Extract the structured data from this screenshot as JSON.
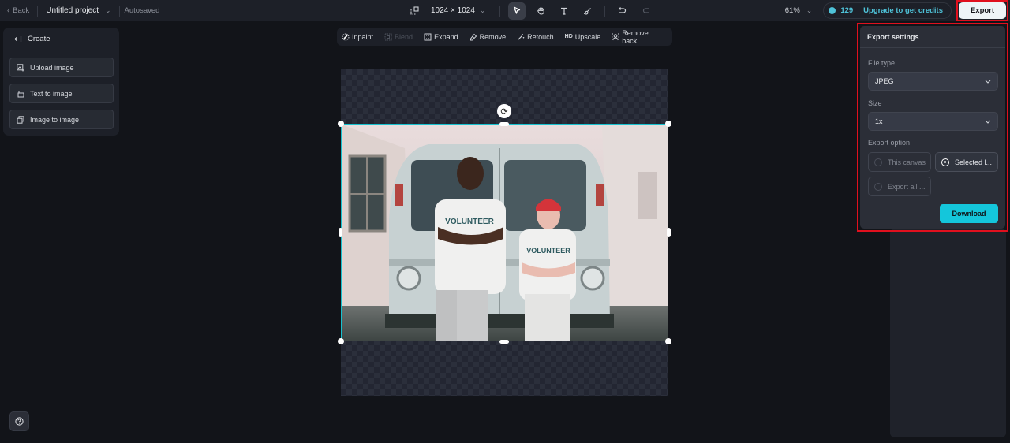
{
  "topbar": {
    "back_label": "Back",
    "project_name": "Untitled project",
    "autosave_status": "Autosaved",
    "canvas_size": "1024 × 1024",
    "zoom_level": "61%",
    "credits_count": "129",
    "upgrade_label": "Upgrade to get credits",
    "export_label": "Export"
  },
  "left_panel": {
    "title": "Create",
    "items": [
      {
        "label": "Upload image",
        "icon": "upload-image-icon"
      },
      {
        "label": "Text to image",
        "icon": "text-to-image-icon"
      },
      {
        "label": "Image to image",
        "icon": "image-to-image-icon"
      }
    ]
  },
  "edit_toolbar": {
    "items": [
      {
        "label": "Inpaint",
        "enabled": true
      },
      {
        "label": "Blend",
        "enabled": false
      },
      {
        "label": "Expand",
        "enabled": true
      },
      {
        "label": "Remove",
        "enabled": true
      },
      {
        "label": "Retouch",
        "enabled": true
      },
      {
        "label": "Upscale",
        "badge": "HD",
        "enabled": true
      },
      {
        "label": "Remove back...",
        "enabled": true
      }
    ]
  },
  "canvas": {
    "image_description": "Two volunteers in VOLUNTEER t-shirts standing in front of a white van",
    "shirt_text": "VOLUNTEER"
  },
  "export_settings": {
    "title": "Export settings",
    "file_type_label": "File type",
    "file_type_value": "JPEG",
    "size_label": "Size",
    "size_value": "1x",
    "export_option_label": "Export option",
    "options": [
      {
        "label": "This canvas",
        "selected": false
      },
      {
        "label": "Selected l...",
        "selected": true
      },
      {
        "label": "Export all ...",
        "selected": false
      }
    ],
    "download_label": "Download"
  },
  "colors": {
    "accent": "#14c6db",
    "selection": "#17c2cf",
    "highlight_box": "#e0101e",
    "background": "#121419"
  }
}
